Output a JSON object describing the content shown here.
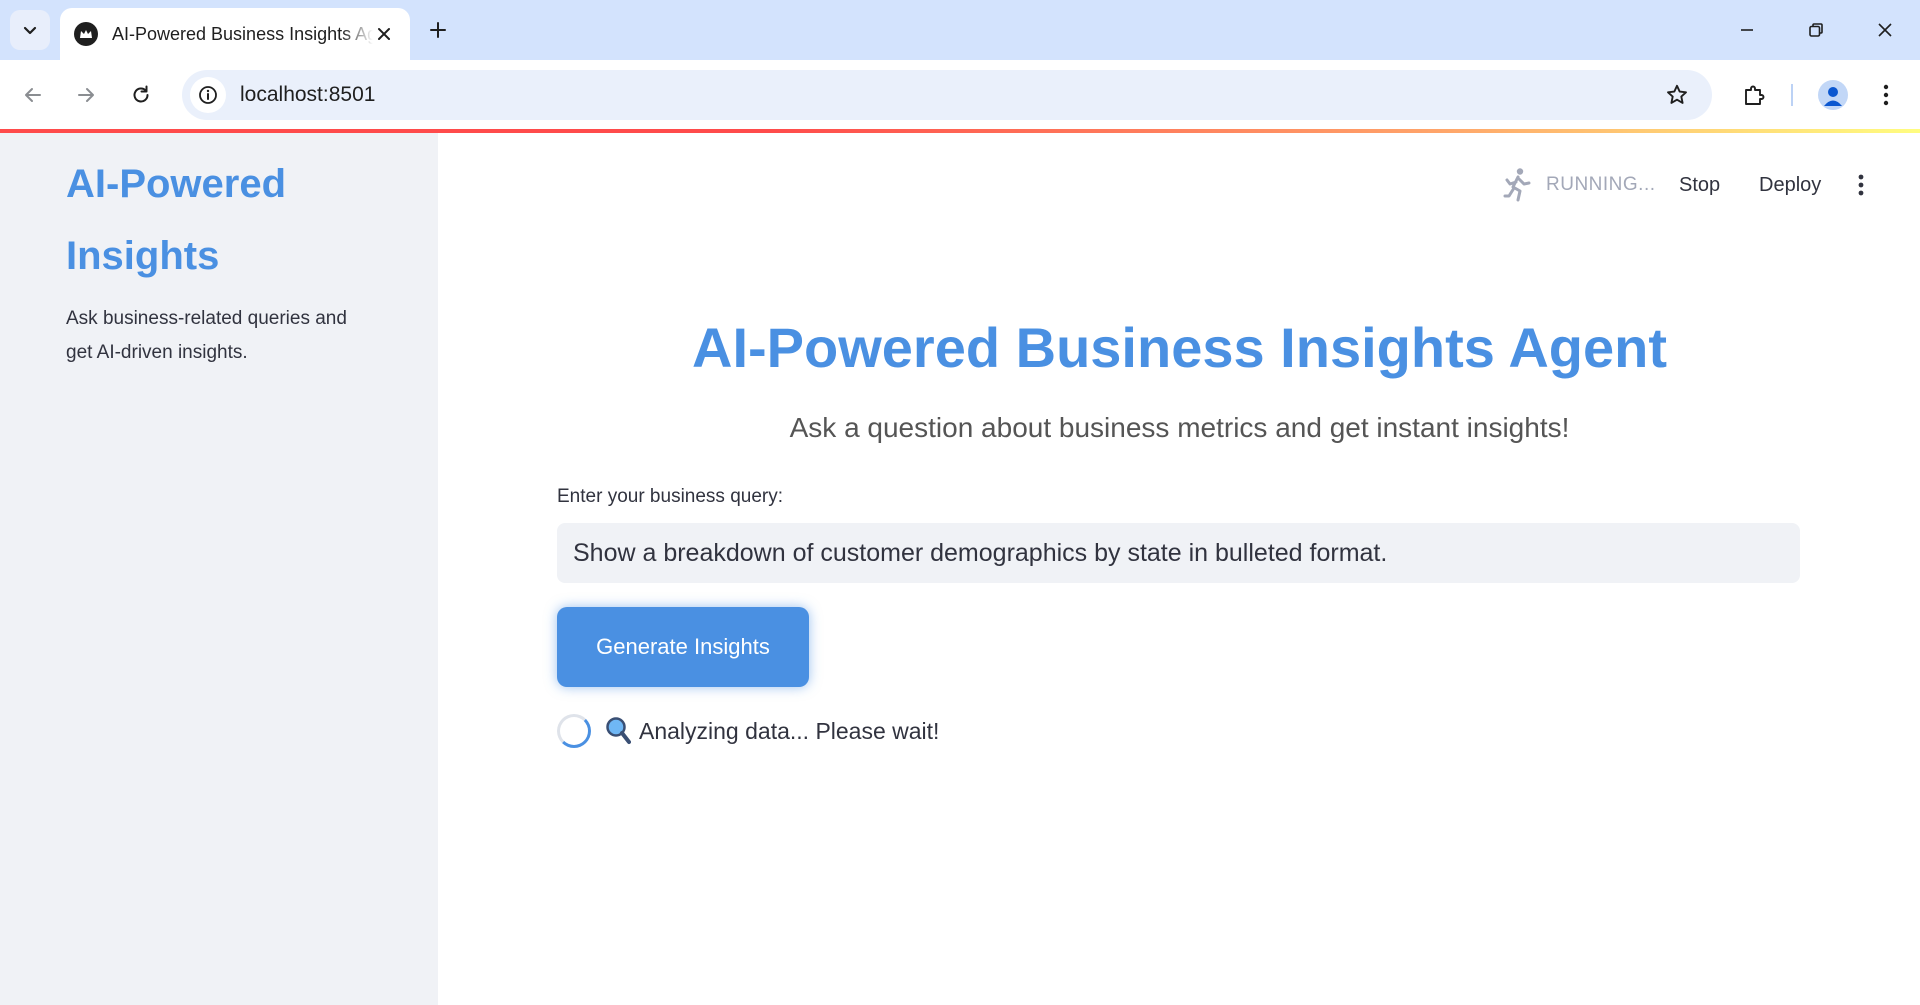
{
  "browser": {
    "tab_title": "AI-Powered Business Insights Agent",
    "url": "localhost:8501"
  },
  "sidebar": {
    "title": "AI-Powered Insights",
    "description": "Ask business-related queries and get AI-driven insights."
  },
  "header": {
    "status": "RUNNING...",
    "stop_label": "Stop",
    "deploy_label": "Deploy"
  },
  "main": {
    "title": "AI-Powered Business Insights Agent",
    "subtitle": "Ask a question about business metrics and get instant insights!",
    "input_label": "Enter your business query:",
    "input_value": "Show a breakdown of customer demographics by state in bulleted format.",
    "button_label": "Generate Insights",
    "spinner_text": "Analyzing data... Please wait!"
  },
  "colors": {
    "accent": "#4a90e2",
    "sidebar_bg": "#f0f2f6",
    "tabbar_bg": "#d3e3fd",
    "text": "#31333f"
  },
  "icons": [
    "tab-search-icon",
    "app-favicon-icon",
    "close-icon",
    "plus-icon",
    "minimize-icon",
    "restore-icon",
    "window-close-icon",
    "back-icon",
    "forward-icon",
    "reload-icon",
    "site-info-icon",
    "star-icon",
    "extensions-icon",
    "profile-icon",
    "menu-icon",
    "running-icon",
    "more-icon",
    "magnifier-icon"
  ]
}
